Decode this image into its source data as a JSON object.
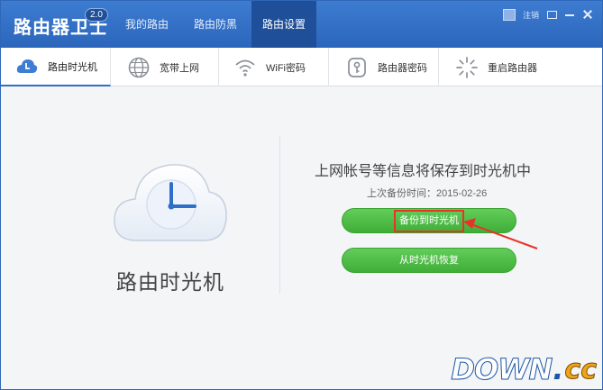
{
  "app": {
    "title": "路由器卫士",
    "version": "2.0"
  },
  "nav": {
    "tabs": [
      {
        "label": "我的路由"
      },
      {
        "label": "路由防黑"
      },
      {
        "label": "路由设置"
      }
    ],
    "active_index": 2
  },
  "top_right": {
    "login_label": "注销"
  },
  "sub_tabs": {
    "items": [
      {
        "label": "路由时光机",
        "icon": "cloud-clock-icon"
      },
      {
        "label": "宽带上网",
        "icon": "globe-icon"
      },
      {
        "label": "WiFi密码",
        "icon": "wifi-icon"
      },
      {
        "label": "路由器密码",
        "icon": "key-icon"
      },
      {
        "label": "重启路由器",
        "icon": "loading-spinner-icon"
      }
    ],
    "active_index": 0
  },
  "main": {
    "hero_label": "路由时光机",
    "headline": "上网帐号等信息将保存到时光机中",
    "backup_time_label": "上次备份时间：2015-02-26",
    "backup_button": "备份到时光机",
    "restore_button": "从时光机恢复"
  },
  "watermark": {
    "main": "DOWN",
    "dot": ".",
    "suffix": "cc"
  },
  "colors": {
    "titlebar": "#2b66bb",
    "active_tab": "#1f4f98",
    "button_green": "#4cbe44",
    "highlight_red": "#e8332b"
  }
}
